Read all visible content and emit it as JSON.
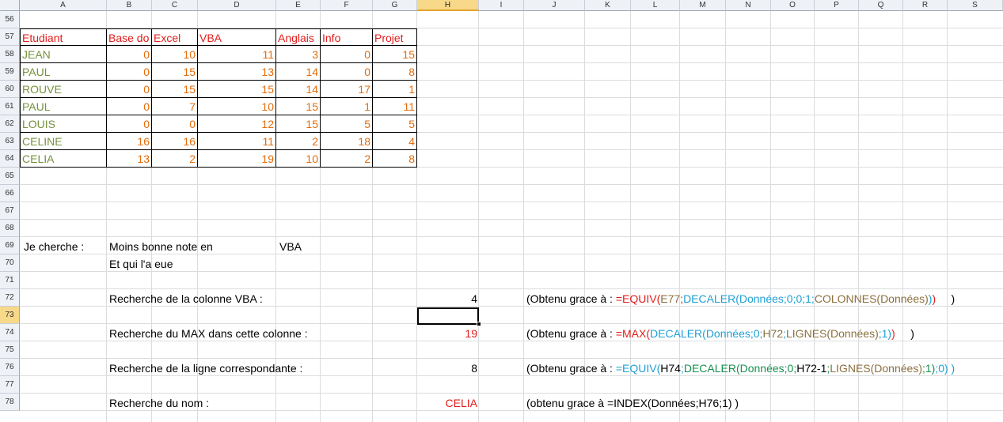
{
  "sheet": {
    "columns": [
      "A",
      "B",
      "C",
      "D",
      "E",
      "F",
      "G",
      "H",
      "I",
      "J",
      "K",
      "L",
      "M",
      "N",
      "O",
      "P",
      "Q",
      "R",
      "S"
    ],
    "selected_column": "H",
    "rows": [
      "56",
      "57",
      "58",
      "59",
      "60",
      "61",
      "62",
      "63",
      "64",
      "65",
      "66",
      "67",
      "68",
      "69",
      "70",
      "71",
      "72",
      "73",
      "74",
      "75",
      "76",
      "77",
      "78"
    ],
    "selected_row": "73"
  },
  "table": {
    "headers": [
      "Etudiant",
      "Base do",
      "Excel",
      "VBA",
      "Anglais",
      "Info",
      "Projet"
    ],
    "rows": [
      [
        "JEAN",
        "0",
        "10",
        "11",
        "3",
        "0",
        "15"
      ],
      [
        "PAUL",
        "0",
        "15",
        "13",
        "14",
        "0",
        "8"
      ],
      [
        "ROUVE",
        "0",
        "15",
        "15",
        "14",
        "17",
        "1"
      ],
      [
        "PAUL",
        "0",
        "7",
        "10",
        "15",
        "1",
        "11"
      ],
      [
        "LOUIS",
        "0",
        "0",
        "12",
        "15",
        "5",
        "5"
      ],
      [
        "CELINE",
        "16",
        "16",
        "11",
        "2",
        "18",
        "4"
      ],
      [
        "CELIA",
        "13",
        "2",
        "19",
        "10",
        "2",
        "8"
      ]
    ]
  },
  "search": {
    "label": "Je cherche :",
    "criterion": "Moins bonne note en",
    "subject": "VBA",
    "who": "Et qui l'a eue"
  },
  "steps": [
    {
      "label": "Recherche de la colonne VBA :",
      "value": "4",
      "formula": [
        {
          "text": "(Obtenu grace à : ",
          "color": "black"
        },
        {
          "text": "=EQUIV(",
          "color": "red"
        },
        {
          "text": "E77",
          "color": "brown"
        },
        {
          "text": ";",
          "color": "red"
        },
        {
          "text": "DECALER(Données;0;0;1;",
          "color": "blue"
        },
        {
          "text": "COLONNES(Données)",
          "color": "brown"
        },
        {
          "text": ")",
          "color": "blue"
        },
        {
          "text": ")",
          "color": "red"
        },
        {
          "text": "     )",
          "color": "black"
        }
      ]
    },
    {
      "label": "Recherche du MAX dans cette colonne :",
      "value": "19",
      "formula": [
        {
          "text": "(Obtenu grace à : ",
          "color": "black"
        },
        {
          "text": "=MAX(",
          "color": "red"
        },
        {
          "text": "DECALER(Données;0;",
          "color": "blue"
        },
        {
          "text": "H72",
          "color": "brown"
        },
        {
          "text": ";",
          "color": "blue"
        },
        {
          "text": "LIGNES(Données)",
          "color": "brown"
        },
        {
          "text": ";1)",
          "color": "blue"
        },
        {
          "text": ")",
          "color": "red"
        },
        {
          "text": "     )",
          "color": "black"
        }
      ]
    },
    {
      "label": "Recherche de la ligne correspondante :",
      "value": "8",
      "formula": [
        {
          "text": "(Obtenu grace à : ",
          "color": "black"
        },
        {
          "text": "=EQUIV(",
          "color": "blue"
        },
        {
          "text": "H74",
          "color": "black"
        },
        {
          "text": ";",
          "color": "blue"
        },
        {
          "text": "DECALER(Données;0;",
          "color": "green"
        },
        {
          "text": "H72-1",
          "color": "black"
        },
        {
          "text": ";",
          "color": "green"
        },
        {
          "text": "LIGNES(Données)",
          "color": "brown"
        },
        {
          "text": ";1)",
          "color": "green"
        },
        {
          "text": ";0) )",
          "color": "blue"
        }
      ]
    },
    {
      "label": "Recherche du nom :",
      "value": "CELIA",
      "formula": [
        {
          "text": "(obtenu grace à =INDEX(Données;H76;1) )",
          "color": "black"
        }
      ]
    }
  ],
  "colors": {
    "header_red": "#e31c1c",
    "name_green": "#76923c",
    "number_orange": "#e46c0a",
    "formula_blue": "#1fa0d4",
    "formula_brown": "#8b6f3e",
    "formula_green": "#178f4f"
  }
}
